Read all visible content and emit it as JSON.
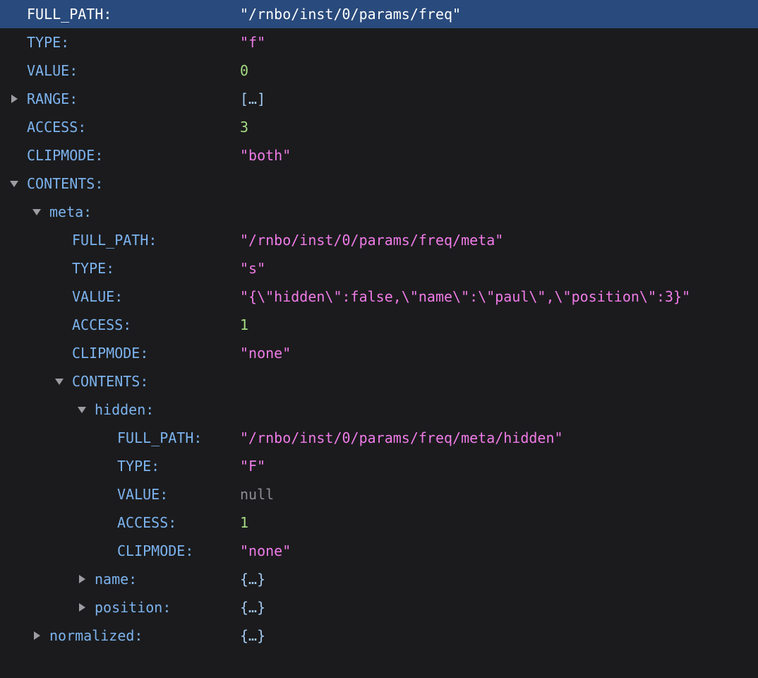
{
  "colors": {
    "background": "#1b1b1d",
    "selection": "#294a7c",
    "key": "#7cb3ee",
    "string": "#ef7be7",
    "number": "#a5dc82",
    "null": "#8d8d93",
    "preview": "#a3c9f0",
    "twisty": "#9c9ca3"
  },
  "rows": [
    {
      "key": "FULL_PATH:",
      "value": "\"/rnbo/inst/0/params/freq\"",
      "type": "string",
      "depth": 0,
      "twisty": "none",
      "selected": true
    },
    {
      "key": "TYPE:",
      "value": "\"f\"",
      "type": "string",
      "depth": 0,
      "twisty": "none"
    },
    {
      "key": "VALUE:",
      "value": "0",
      "type": "number",
      "depth": 0,
      "twisty": "none"
    },
    {
      "key": "RANGE:",
      "value": "[…]",
      "type": "preview",
      "depth": 0,
      "twisty": "collapsed"
    },
    {
      "key": "ACCESS:",
      "value": "3",
      "type": "number",
      "depth": 0,
      "twisty": "none"
    },
    {
      "key": "CLIPMODE:",
      "value": "\"both\"",
      "type": "string",
      "depth": 0,
      "twisty": "none"
    },
    {
      "key": "CONTENTS:",
      "value": "",
      "type": "none",
      "depth": 0,
      "twisty": "expanded"
    },
    {
      "key": "meta:",
      "value": "",
      "type": "none",
      "depth": 1,
      "twisty": "expanded"
    },
    {
      "key": "FULL_PATH:",
      "value": "\"/rnbo/inst/0/params/freq/meta\"",
      "type": "string",
      "depth": 2,
      "twisty": "none"
    },
    {
      "key": "TYPE:",
      "value": "\"s\"",
      "type": "string",
      "depth": 2,
      "twisty": "none"
    },
    {
      "key": "VALUE:",
      "value": "\"{\\\"hidden\\\":false,\\\"name\\\":\\\"paul\\\",\\\"position\\\":3}\"",
      "type": "string",
      "depth": 2,
      "twisty": "none"
    },
    {
      "key": "ACCESS:",
      "value": "1",
      "type": "number",
      "depth": 2,
      "twisty": "none"
    },
    {
      "key": "CLIPMODE:",
      "value": "\"none\"",
      "type": "string",
      "depth": 2,
      "twisty": "none"
    },
    {
      "key": "CONTENTS:",
      "value": "",
      "type": "none",
      "depth": 2,
      "twisty": "expanded"
    },
    {
      "key": "hidden:",
      "value": "",
      "type": "none",
      "depth": 3,
      "twisty": "expanded"
    },
    {
      "key": "FULL_PATH:",
      "value": "\"/rnbo/inst/0/params/freq/meta/hidden\"",
      "type": "string",
      "depth": 4,
      "twisty": "none"
    },
    {
      "key": "TYPE:",
      "value": "\"F\"",
      "type": "string",
      "depth": 4,
      "twisty": "none"
    },
    {
      "key": "VALUE:",
      "value": "null",
      "type": "null",
      "depth": 4,
      "twisty": "none"
    },
    {
      "key": "ACCESS:",
      "value": "1",
      "type": "number",
      "depth": 4,
      "twisty": "none"
    },
    {
      "key": "CLIPMODE:",
      "value": "\"none\"",
      "type": "string",
      "depth": 4,
      "twisty": "none"
    },
    {
      "key": "name:",
      "value": "{…}",
      "type": "preview",
      "depth": 3,
      "twisty": "collapsed"
    },
    {
      "key": "position:",
      "value": "{…}",
      "type": "preview",
      "depth": 3,
      "twisty": "collapsed"
    },
    {
      "key": "normalized:",
      "value": "{…}",
      "type": "preview",
      "depth": 1,
      "twisty": "collapsed"
    }
  ]
}
